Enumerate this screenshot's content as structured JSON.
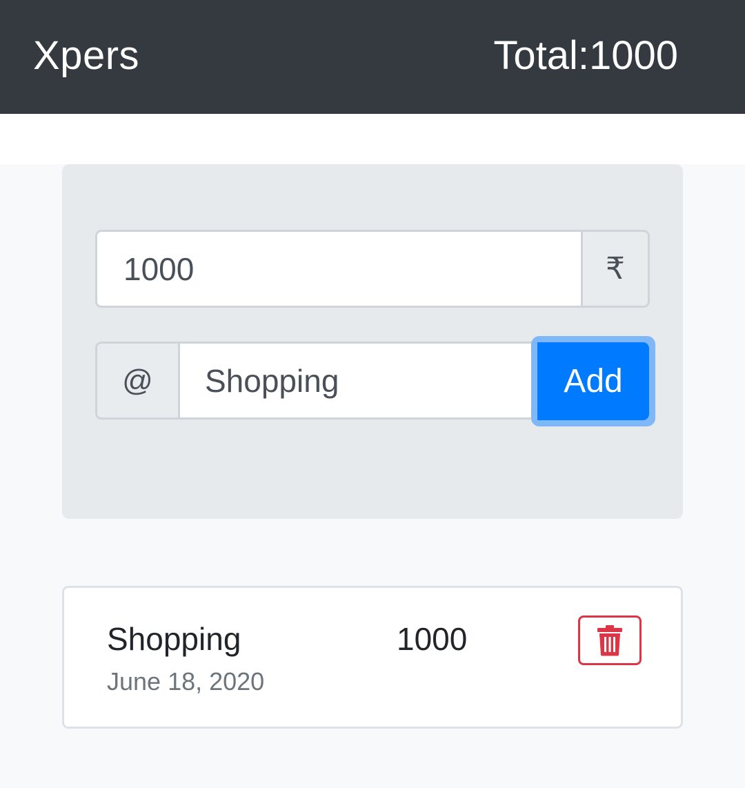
{
  "navbar": {
    "brand": "Xpers",
    "total_label": "Total:",
    "total_value": "1000"
  },
  "form": {
    "amount_value": "1000",
    "currency_symbol": "₹",
    "note_prefix": "@",
    "note_value": "Shopping",
    "add_label": "Add"
  },
  "expenses": [
    {
      "title": "Shopping",
      "date": "June 18, 2020",
      "amount": "1000",
      "delete_icon": "trash-icon"
    }
  ],
  "colors": {
    "navbar": "#343a40",
    "primary": "#007bff",
    "danger": "#dc3545"
  }
}
